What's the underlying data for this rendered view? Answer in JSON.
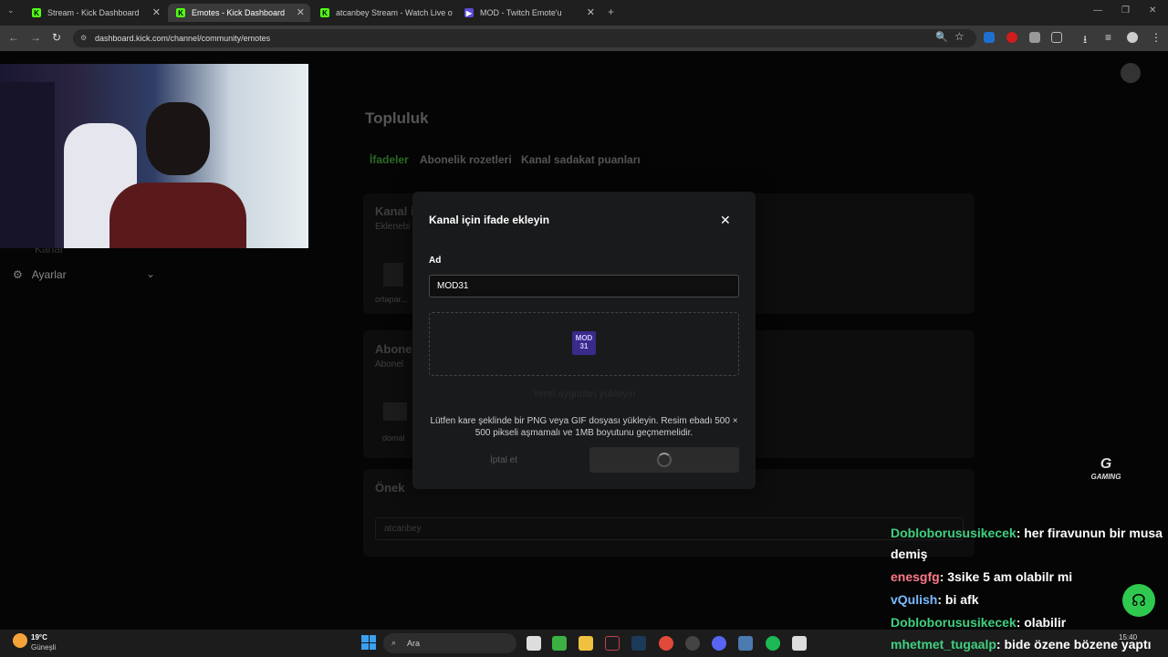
{
  "browser": {
    "tabs": [
      {
        "title": "Stream - Kick Dashboard",
        "active": false,
        "icon": "kick-icon"
      },
      {
        "title": "Emotes - Kick Dashboard",
        "active": true,
        "icon": "kick-icon"
      },
      {
        "title": "atcanbey Stream - Watch Live o",
        "active": false,
        "icon": "kick-icon"
      },
      {
        "title": "MOD - Twitch Emote'u",
        "active": false,
        "icon": "twitch-emote-icon"
      }
    ],
    "url": "dashboard.kick.com/channel/community/emotes"
  },
  "page": {
    "title": "Topluluk",
    "tabs": [
      "İfadeler",
      "Abonelik rozetleri",
      "Kanal sadakat puanları"
    ],
    "sections": [
      {
        "title": "Kanal i",
        "subtitle": "Eklenebi",
        "item_label": "ortapar..."
      },
      {
        "title": "Abone",
        "subtitle": "Abonel",
        "item_label": "domal"
      }
    ],
    "prefix_label": "Önek",
    "prefix_value": "atcanbey",
    "sidebar_settings": "Ayarlar",
    "sidebar_partial": "Kanal"
  },
  "modal": {
    "title": "Kanal için ifade ekleyin",
    "name_label": "Ad",
    "name_value": "MOD31",
    "emote_preview_text": "MOD 31",
    "upload_link": "Yerel aygıtdan yükleyin",
    "helper_text": "Lütfen kare şeklinde bir PNG veya GIF dosyası yükleyin. Resim ebadı 500 × 500 pikseli aşmamalı ve 1MB boyutunu geçmemelidir.",
    "cancel_label": "İptal et"
  },
  "chat": [
    {
      "user": "Dobloborususikecek",
      "message": ": her firavunun bir musa"
    },
    {
      "user": "",
      "message": "demiş"
    },
    {
      "user": "enesgfg",
      "message": ": 3sike 5 am olabilr mi",
      "color": "#ff7a8a"
    },
    {
      "user": "vQulish",
      "message": ": bi afk",
      "color": "#7ab8ff"
    },
    {
      "user": "Dobloborususikecek",
      "message": ": olabilir"
    },
    {
      "user": "mhetmet_tugaalp",
      "message": ": bide özene bözene yaptı"
    }
  ],
  "overlay_logo": "GAMING",
  "taskbar": {
    "weather_temp": "19°C",
    "weather_desc": "Güneşli",
    "search_placeholder": "Ara",
    "time": "15:40"
  }
}
